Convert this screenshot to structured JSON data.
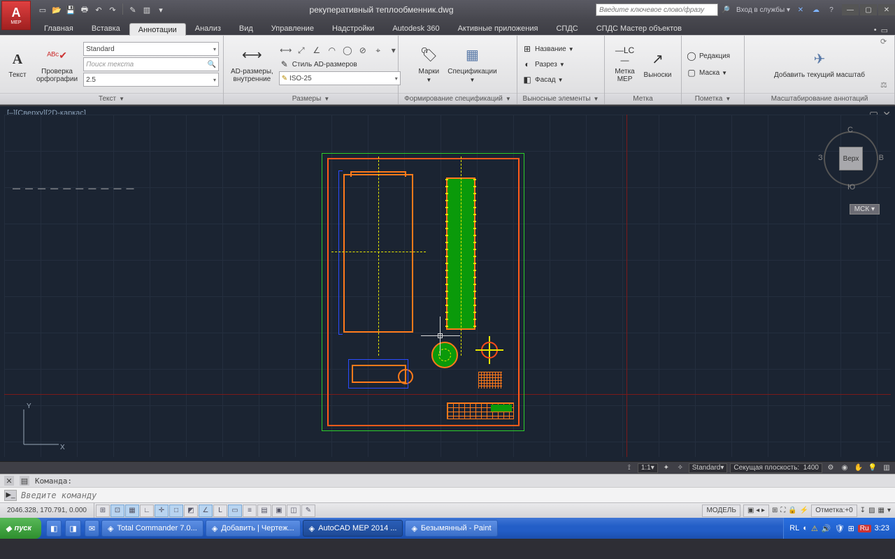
{
  "title": "рекуперативный теплообменник.dwg",
  "search_placeholder": "Введите ключевое слово/фразу",
  "signin": "Вход в службы",
  "tabs": [
    "Главная",
    "Вставка",
    "Аннотации",
    "Анализ",
    "Вид",
    "Управление",
    "Надстройки",
    "Autodesk 360",
    "Активные приложения",
    "СПДС",
    "СПДС Мастер объектов"
  ],
  "active_tab_index": 2,
  "ribbon": {
    "text": {
      "title": "Текст",
      "btn_text": "Текст",
      "btn_spell": "Проверка\nорфографии",
      "style": "Standard",
      "find": "Поиск текста",
      "height": "2.5"
    },
    "dims": {
      "title": "Размеры",
      "btn": "AD-размеры,\nвнутренние",
      "row2": "Стиль AD-размеров",
      "combo": "ISO-25"
    },
    "spec": {
      "title": "Формирование спецификаций",
      "btn1": "Марки",
      "btn2": "Спецификации"
    },
    "callout": {
      "title": "Выносные элементы",
      "r1": "Название",
      "r2": "Разрез",
      "r3": "Фасад"
    },
    "label": {
      "title": "Метка",
      "btn1": "Метка\nMEP",
      "btn2": "Выноски"
    },
    "markup": {
      "title": "Пометка",
      "r1": "Редакция",
      "r2": "Маска"
    },
    "scale": {
      "title": "Масштабирование аннотаций",
      "btn": "Добавить текущий масштаб"
    }
  },
  "view_label": "[–][Сверху][2D-каркас]",
  "cube": {
    "face": "Верх",
    "n": "С",
    "s": "Ю",
    "w": "З",
    "e": "В",
    "mck": "МСК"
  },
  "statusbar_right": {
    "scale": "1:1",
    "style": "Standard",
    "cutplane_label": "Секущая плоскость:",
    "cutplane_val": "1400"
  },
  "cmd": {
    "label": "Команда:",
    "placeholder": "Введите команду"
  },
  "status": {
    "coords": "2046.328, 170.791, 0.000",
    "model": "МОДЕЛЬ",
    "elev_label": "Отметка:",
    "elev_val": "+0"
  },
  "taskbar": {
    "start": "пуск",
    "items": [
      {
        "label": "Total Commander 7.0..."
      },
      {
        "label": "Добавить | Чертеж..."
      },
      {
        "label": "AutoCAD MEP 2014 ...",
        "active": true
      },
      {
        "label": "Безымянный - Paint"
      }
    ],
    "lang_small": "RL",
    "lang": "Ru",
    "clock": "3:23"
  },
  "ucs": {
    "x": "X",
    "y": "Y"
  },
  "app_logo_sub": "MEP"
}
